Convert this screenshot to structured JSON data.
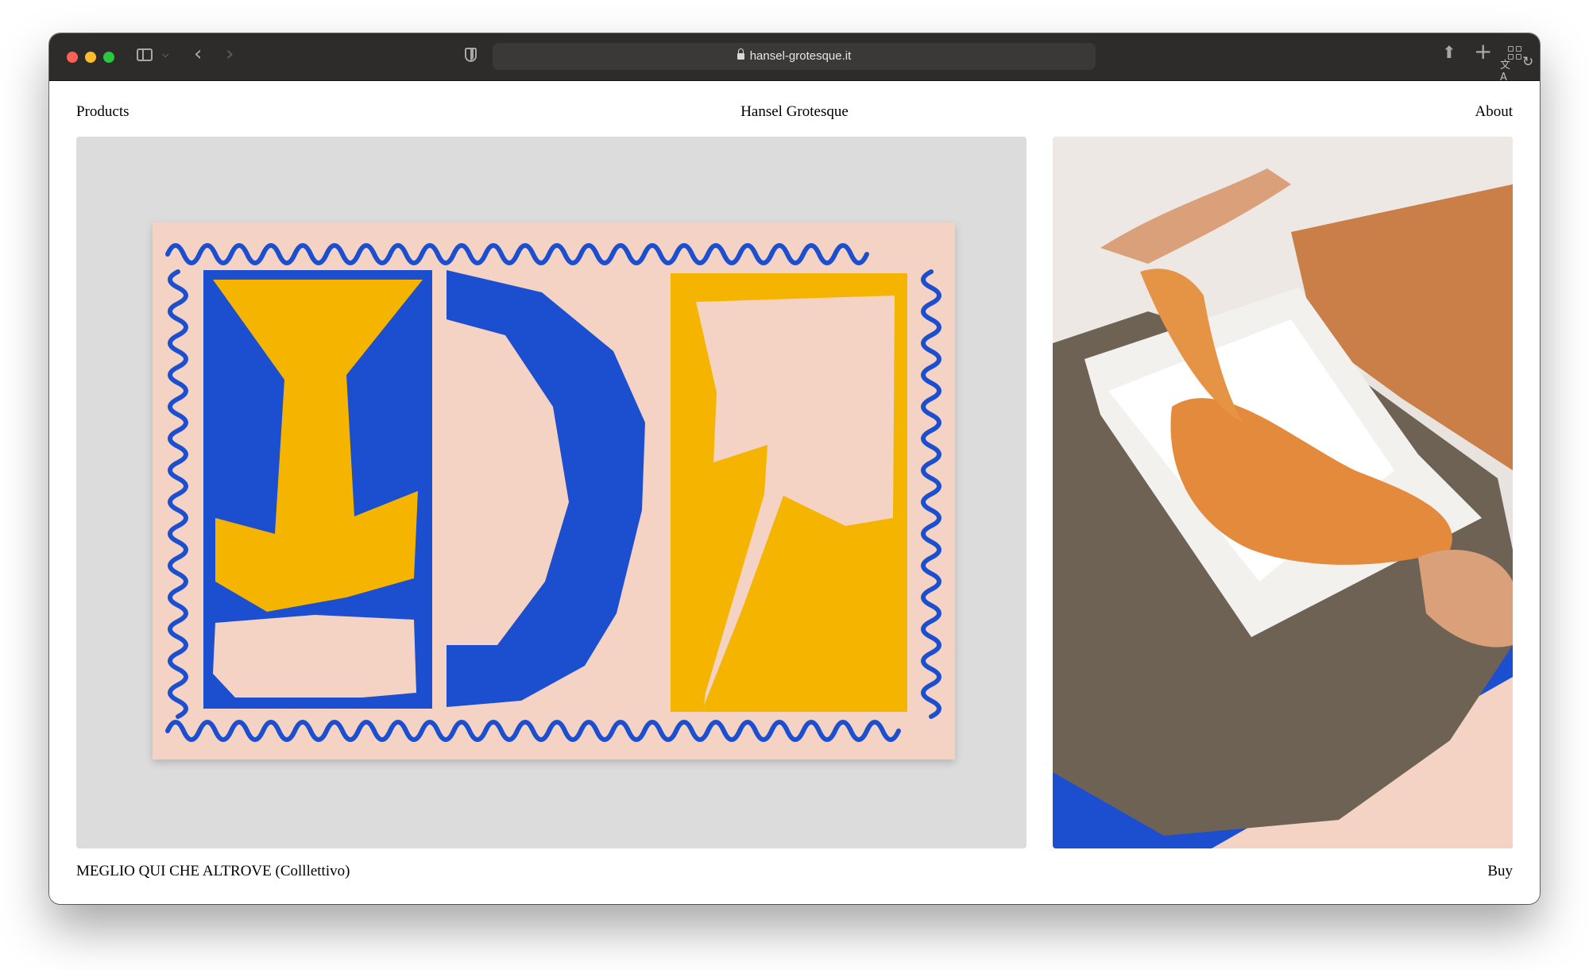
{
  "browser": {
    "url": "hansel-grotesque.it"
  },
  "site": {
    "nav": {
      "products": "Products",
      "brand": "Hansel Grotesque",
      "about": "About"
    },
    "product": {
      "title": "MEGLIO QUI CHE ALTROVE (Colllettivo)",
      "buy": "Buy"
    }
  },
  "colors": {
    "rug_blue": "#1c4fcf",
    "rug_yellow": "#f5b400",
    "rug_pink": "#f4d3c4",
    "panel_gray": "#dcdcdc"
  },
  "icons": [
    "sidebar-icon",
    "chevron-down-icon",
    "back-icon",
    "forward-icon",
    "shield-icon",
    "lock-icon",
    "translate-icon",
    "reload-icon",
    "share-icon",
    "new-tab-icon",
    "tab-overview-icon"
  ]
}
